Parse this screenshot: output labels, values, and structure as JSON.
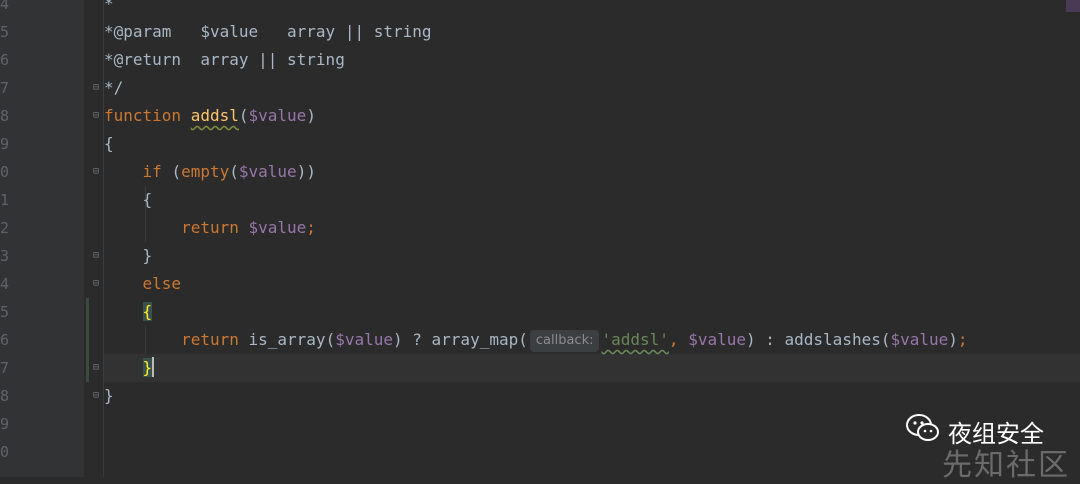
{
  "gutter": {
    "line_numbers": [
      "4",
      "5",
      "6",
      "7",
      "8",
      "9",
      "0",
      "1",
      "2",
      "3",
      "4",
      "5",
      "6",
      "7",
      "8",
      "9",
      "0"
    ]
  },
  "code": {
    "lines": [
      [
        {
          "t": "*",
          "c": "c-comment"
        }
      ],
      [
        {
          "t": "*@param   $value   array || string",
          "c": "c-comment"
        }
      ],
      [
        {
          "t": "*@return  array || string",
          "c": "c-comment"
        }
      ],
      [
        {
          "t": "*/",
          "c": "c-comment"
        }
      ],
      [
        {
          "t": "function ",
          "c": "c-kw"
        },
        {
          "t": "addsl",
          "c": "c-fn"
        },
        {
          "t": "(",
          "c": ""
        },
        {
          "t": "$value",
          "c": "c-var"
        },
        {
          "t": ")",
          "c": ""
        }
      ],
      [
        {
          "t": "{",
          "c": ""
        }
      ],
      [
        {
          "t": "    ",
          "c": ""
        },
        {
          "t": "if ",
          "c": "c-kw"
        },
        {
          "t": "(",
          "c": ""
        },
        {
          "t": "empty",
          "c": "c-kw"
        },
        {
          "t": "(",
          "c": ""
        },
        {
          "t": "$value",
          "c": "c-var"
        },
        {
          "t": "))",
          "c": ""
        }
      ],
      [
        {
          "t": "    {",
          "c": ""
        }
      ],
      [
        {
          "t": "        ",
          "c": ""
        },
        {
          "t": "return ",
          "c": "c-kw"
        },
        {
          "t": "$value",
          "c": "c-var"
        },
        {
          "t": ";",
          "c": "c-kw"
        }
      ],
      [
        {
          "t": "    }",
          "c": ""
        }
      ],
      [
        {
          "t": "    ",
          "c": ""
        },
        {
          "t": "else",
          "c": "c-kw"
        }
      ],
      [
        {
          "t": "    ",
          "c": ""
        },
        {
          "t": "{",
          "c": "c-brace-hl"
        }
      ],
      [
        {
          "t": "        ",
          "c": ""
        },
        {
          "t": "return ",
          "c": "c-kw"
        },
        {
          "t": "is_array(",
          "c": ""
        },
        {
          "t": "$value",
          "c": "c-var"
        },
        {
          "t": ") ? array_map(",
          "c": ""
        },
        {
          "hint": "callback:"
        },
        {
          "t": "'addsl'",
          "c": "c-str-ul"
        },
        {
          "t": ", ",
          "c": "c-kw"
        },
        {
          "t": "$value",
          "c": "c-var"
        },
        {
          "t": ") : addslashes(",
          "c": ""
        },
        {
          "t": "$value",
          "c": "c-var"
        },
        {
          "t": ")",
          "c": ""
        },
        {
          "t": ";",
          "c": "c-kw"
        }
      ],
      [
        {
          "t": "    ",
          "c": ""
        },
        {
          "t": "}",
          "c": "c-brace-hl"
        },
        {
          "caret": true
        }
      ],
      [
        {
          "t": "}",
          "c": ""
        }
      ],
      [],
      []
    ]
  },
  "watermark": {
    "brand": "夜组安全",
    "site": "先知社区"
  },
  "colors": {
    "background": "#2b2b2b",
    "keyword": "#cc7832",
    "function": "#ffc66d",
    "variable": "#9876aa",
    "string": "#6a8759"
  }
}
